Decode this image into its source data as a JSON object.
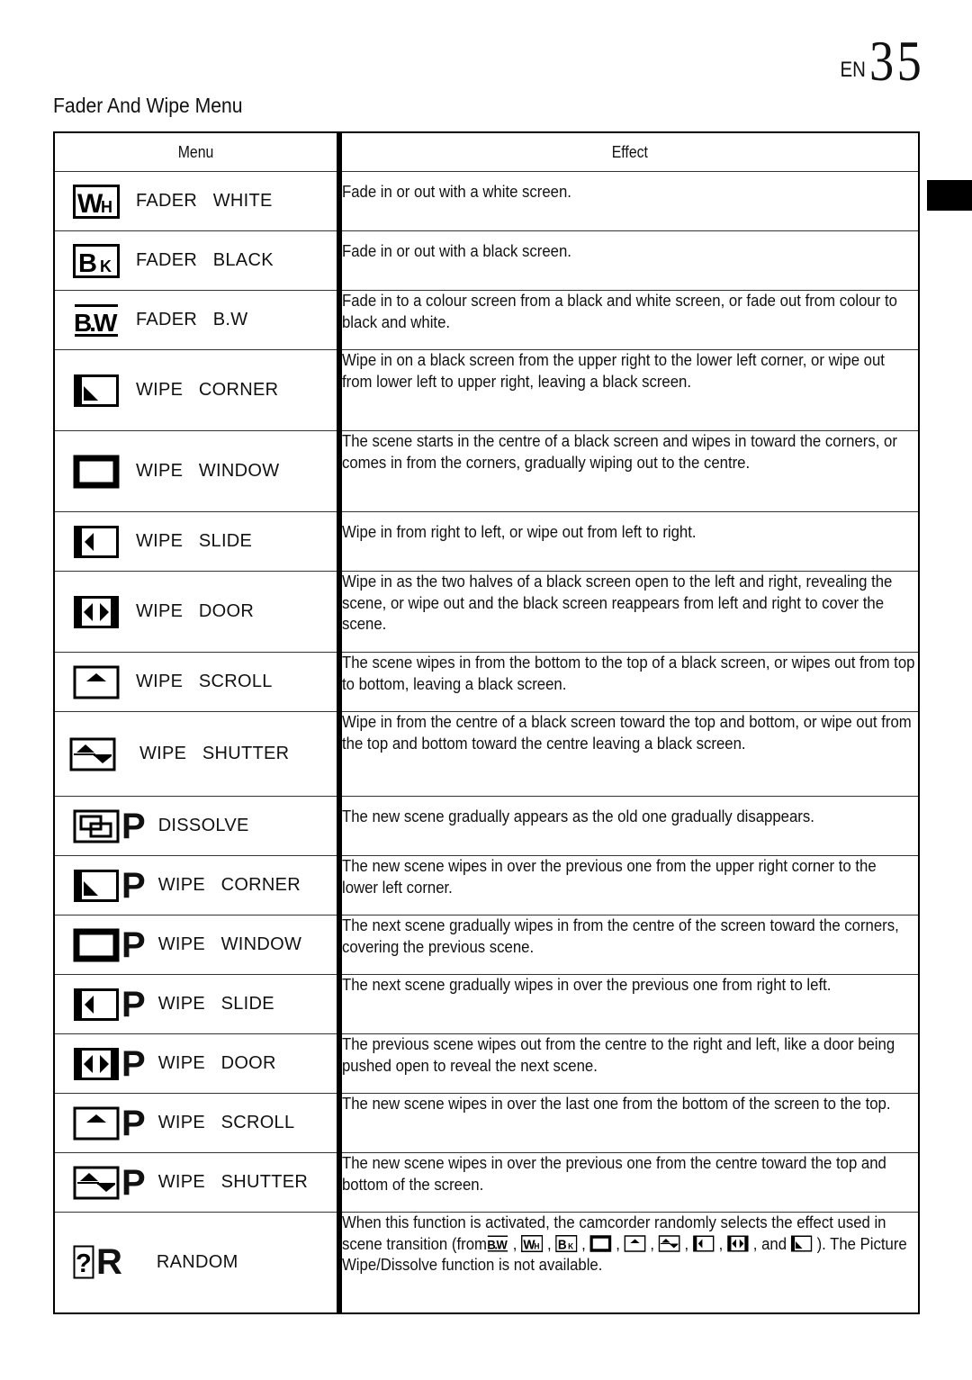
{
  "page": {
    "prefix": "EN",
    "number": "35",
    "title": "Fader And Wipe Menu"
  },
  "table": {
    "headers": {
      "menu": "Menu",
      "effect": "Effect"
    },
    "rows": [
      {
        "icon": "fader-white-icon",
        "picture": false,
        "label": "FADER   WHITE",
        "effect": "Fade in or out with a white screen."
      },
      {
        "icon": "fader-black-icon",
        "picture": false,
        "label": "FADER   BLACK",
        "effect": "Fade in or out with a black screen."
      },
      {
        "icon": "fader-bw-icon",
        "picture": false,
        "label": "FADER   B.W",
        "effect": "Fade in to a colour screen from a black and white screen, or fade out from colour to black and white."
      },
      {
        "icon": "wipe-corner-icon",
        "picture": false,
        "label": "WIPE   CORNER",
        "effect": "Wipe in on a black screen from the upper right to the lower left corner, or wipe out from lower left to upper right, leaving a black screen."
      },
      {
        "icon": "wipe-window-icon",
        "picture": false,
        "label": "WIPE   WINDOW",
        "effect": "The scene starts in the centre of a black screen and wipes in toward the corners, or comes in from the corners, gradually wiping out to the centre."
      },
      {
        "icon": "wipe-slide-icon",
        "picture": false,
        "label": "WIPE   SLIDE",
        "effect": "Wipe in from right to left, or wipe out from left to right."
      },
      {
        "icon": "wipe-door-icon",
        "picture": false,
        "label": "WIPE   DOOR",
        "effect": "Wipe in as the two halves of a black screen open to the left and right, revealing the scene, or wipe out and the black screen reappears from left and right to cover the scene."
      },
      {
        "icon": "wipe-scroll-icon",
        "picture": false,
        "label": "WIPE   SCROLL",
        "effect": "The scene wipes in from the bottom to the top of a black screen, or wipes out from top to bottom, leaving a black screen."
      },
      {
        "icon": "wipe-shutter-icon",
        "picture": false,
        "label": "WIPE   SHUTTER",
        "effect": "Wipe in from the centre of a black screen toward the top and bottom, or wipe out from the top and bottom toward the centre leaving a black screen."
      },
      {
        "icon": "dissolve-icon",
        "picture": true,
        "label": "DISSOLVE",
        "effect": "The new scene gradually appears as the old one gradually disappears."
      },
      {
        "icon": "wipe-corner-icon",
        "picture": true,
        "label": "WIPE   CORNER",
        "effect": "The new scene wipes in over the previous one from the upper right corner to the lower left corner."
      },
      {
        "icon": "wipe-window-icon",
        "picture": true,
        "label": "WIPE   WINDOW",
        "effect": "The next scene gradually wipes in from the centre of the screen toward the corners, covering the previous scene."
      },
      {
        "icon": "wipe-slide-icon",
        "picture": true,
        "label": "WIPE   SLIDE",
        "effect": "The next scene gradually wipes in over the previous one from right to left."
      },
      {
        "icon": "wipe-door-icon",
        "picture": true,
        "label": "WIPE   DOOR",
        "effect": "The previous scene wipes out from the centre to the right and left, like a door being pushed open to reveal the next scene."
      },
      {
        "icon": "wipe-scroll-icon",
        "picture": true,
        "label": "WIPE   SCROLL",
        "effect": "The new scene wipes in over the last one from the bottom of the screen to the top."
      },
      {
        "icon": "wipe-shutter-icon",
        "picture": true,
        "label": "WIPE   SHUTTER",
        "effect": "The new scene wipes in over the previous one from the centre toward the top and bottom of the screen."
      }
    ],
    "random": {
      "icon": "random-icon",
      "label": "RANDOM",
      "effect_part1": "When this function is activated, the camcorder randomly selects the effect used in scene transition (from",
      "inline_icons": [
        "fader-bw-icon",
        "fader-white-icon",
        "fader-black-icon",
        "wipe-window-icon",
        "wipe-scroll-icon",
        "wipe-shutter-icon",
        "wipe-slide-icon",
        "wipe-door-icon",
        "wipe-corner-icon"
      ],
      "and_word": "and",
      "effect_part2": "). The Picture Wipe/Dissolve function is not available."
    },
    "picture_mark": "P",
    "random_mark": "R"
  }
}
